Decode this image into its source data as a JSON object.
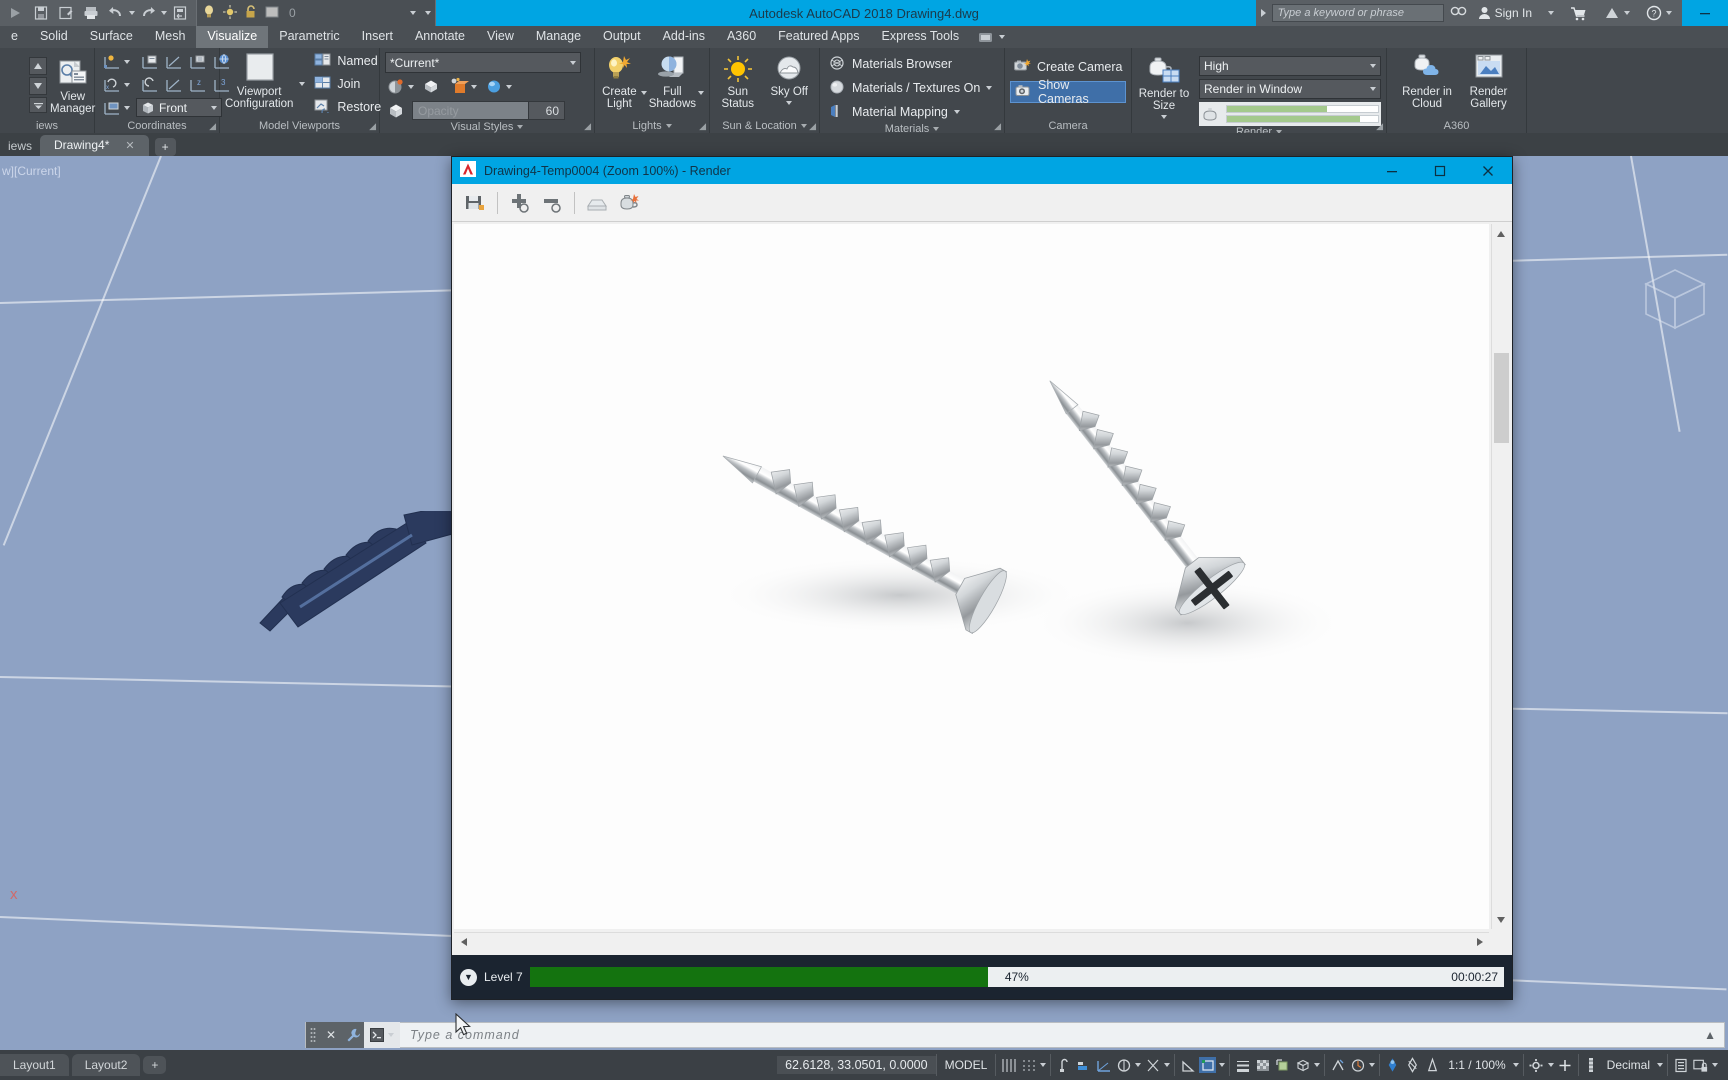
{
  "titlebar": {
    "app_title": "Autodesk AutoCAD 2018   Drawing4.dwg",
    "search_placeholder": "Type a keyword or phrase",
    "sign_in": "Sign In",
    "layer_value": "0",
    "qat": [
      {
        "name": "new-icon",
        "tip": "New"
      },
      {
        "name": "save-icon",
        "tip": "Save"
      },
      {
        "name": "save-as-icon",
        "tip": "Save As"
      },
      {
        "name": "plot-icon",
        "tip": "Plot"
      },
      {
        "name": "undo-icon",
        "tip": "Undo"
      },
      {
        "name": "redo-icon",
        "tip": "Redo"
      },
      {
        "name": "workspace-icon",
        "tip": "Workspace"
      }
    ]
  },
  "ribbon_tabs": [
    {
      "label": "e",
      "active": false
    },
    {
      "label": "Solid",
      "active": false
    },
    {
      "label": "Surface",
      "active": false
    },
    {
      "label": "Mesh",
      "active": false
    },
    {
      "label": "Visualize",
      "active": true
    },
    {
      "label": "Parametric",
      "active": false
    },
    {
      "label": "Insert",
      "active": false
    },
    {
      "label": "Annotate",
      "active": false
    },
    {
      "label": "View",
      "active": false
    },
    {
      "label": "Manage",
      "active": false
    },
    {
      "label": "Output",
      "active": false
    },
    {
      "label": "Add-ins",
      "active": false
    },
    {
      "label": "A360",
      "active": false
    },
    {
      "label": "Featured Apps",
      "active": false
    },
    {
      "label": "Express Tools",
      "active": false
    }
  ],
  "panels": {
    "views": {
      "title": "iews",
      "view_manager": "View\nManager",
      "view_manager_line1": "View",
      "view_manager_line2": "Manager"
    },
    "coordinates": {
      "title": "Coordinates",
      "ucs_combo": "Front"
    },
    "model_viewports": {
      "title": "Model Viewports",
      "viewport_config_line1": "Viewport",
      "viewport_config_line2": "Configuration",
      "items": [
        {
          "label": "Named",
          "icon": "named-viewports-icon"
        },
        {
          "label": "Join",
          "icon": "join-viewports-icon"
        },
        {
          "label": "Restore",
          "icon": "restore-viewport-icon"
        }
      ]
    },
    "visual_styles": {
      "title": "Visual Styles",
      "current_style": "*Current*",
      "opacity_placeholder": "Opacity",
      "opacity_value": "60"
    },
    "lights": {
      "title": "Lights",
      "create_light_line1": "Create",
      "create_light_line2": "Light",
      "full_shadows_line1": "Full",
      "full_shadows_line2": "Shadows"
    },
    "sun_location": {
      "title": "Sun & Location",
      "sun_status_line1": "Sun",
      "sun_status_line2": "Status",
      "sky_off": "Sky Off"
    },
    "materials": {
      "title": "Materials",
      "items": [
        {
          "label": "Materials Browser",
          "icon": "materials-browser-icon",
          "dropdown": false
        },
        {
          "label": "Materials / Textures On",
          "icon": "materials-textures-icon",
          "dropdown": true
        },
        {
          "label": "Material Mapping",
          "icon": "material-mapping-icon",
          "dropdown": true
        }
      ]
    },
    "camera": {
      "title": "Camera",
      "items": [
        {
          "label": "Create Camera",
          "icon": "create-camera-icon",
          "selected": false
        },
        {
          "label": "Show  Cameras",
          "icon": "show-cameras-icon",
          "selected": true
        }
      ]
    },
    "render": {
      "title": "Render",
      "render_to_size_line1": "Render to Size",
      "quality_preset": "High",
      "destination": "Render in Window"
    },
    "a360": {
      "title": "A360",
      "render_cloud_line1": "Render in",
      "render_cloud_line2": "Cloud",
      "render_gallery_line1": "Render",
      "render_gallery_line2": "Gallery"
    }
  },
  "doctabs": {
    "left_label": "iews",
    "tab_name": "Drawing4*",
    "close_glyph": "✕",
    "plus_glyph": "+"
  },
  "canvas": {
    "viewport_label": "w][Current]",
    "ucs_x_label": "x"
  },
  "render_window": {
    "title": "Drawing4-Temp0004 (Zoom 100%) - Render",
    "app_icon": "autocad-a-icon",
    "minimize_glyph": "─",
    "maximize_glyph": "☐",
    "close_glyph": "✕",
    "toolbar": [
      {
        "name": "save-image-icon"
      },
      {
        "name": "zoom-in-icon"
      },
      {
        "name": "zoom-out-icon"
      },
      {
        "name": "print-icon"
      },
      {
        "name": "render-teapot-icon"
      }
    ],
    "status": {
      "level_label": "Level 7",
      "percent": "47%",
      "percent_value": 47,
      "elapsed": "00:00:27",
      "expand_glyph": "▼"
    }
  },
  "command_line": {
    "placeholder": "Type a command",
    "close_glyph": "✕",
    "wrench_glyph": "🔧",
    "prompt_glyph": ">_",
    "expand_glyph": "▲"
  },
  "layout_tabs": [
    {
      "label": "Layout1"
    },
    {
      "label": "Layout2"
    }
  ],
  "layout_plus": "+",
  "status_bar": {
    "coords": "62.6128, 33.0501, 0.0000",
    "space": "MODEL",
    "scale": "1:1 / 100%",
    "units": "Decimal",
    "items": [
      {
        "name": "grid-display-icon"
      },
      {
        "name": "snap-mode-icon"
      },
      {
        "name": "ortho-mode-icon"
      },
      {
        "name": "polar-tracking-icon"
      },
      {
        "name": "isometric-drafting-icon"
      },
      {
        "name": "object-snap-tracking-icon"
      },
      {
        "name": "object-snap-icon"
      },
      {
        "name": "lineweight-icon"
      },
      {
        "name": "transparency-icon"
      },
      {
        "name": "selection-cycling-icon"
      },
      {
        "name": "3d-object-snap-icon"
      },
      {
        "name": "dynamic-ucs-icon"
      },
      {
        "name": "annotation-visibility-icon"
      },
      {
        "name": "autoscale-icon"
      },
      {
        "name": "workspace-switching-icon"
      },
      {
        "name": "annotation-monitor-icon"
      },
      {
        "name": "units-icon"
      },
      {
        "name": "quick-properties-icon"
      },
      {
        "name": "isolate-objects-icon"
      },
      {
        "name": "hardware-acceleration-icon"
      }
    ]
  },
  "colors": {
    "titlebar_blue": "#00a5e3",
    "ribbon_gray": "#42474c",
    "canvas_blue": "#8ea2c4",
    "progress_green": "#14730f",
    "selection_blue": "#3f6fa8",
    "render_status_bg": "#1b2430"
  }
}
